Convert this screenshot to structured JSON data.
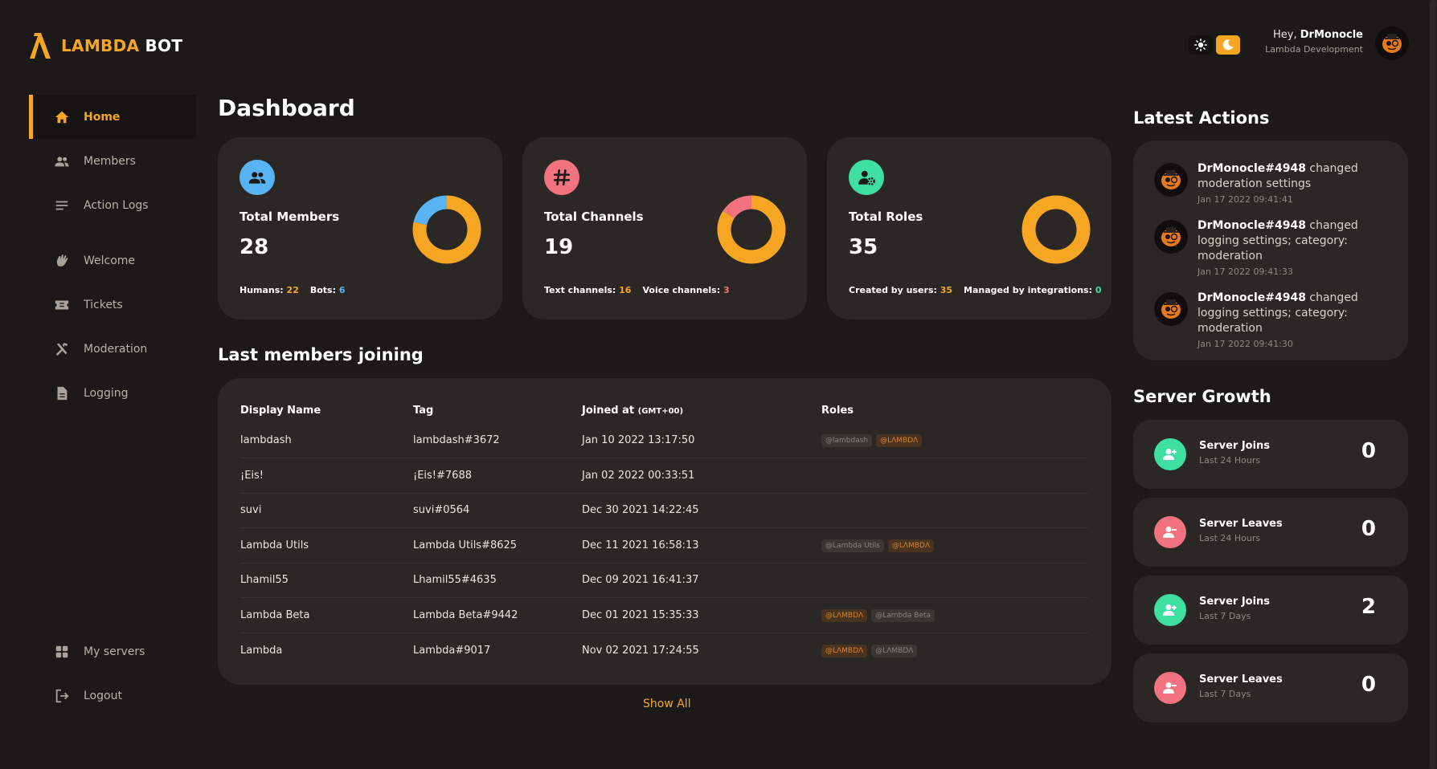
{
  "brand": {
    "name_accent": "LAMBDA",
    "name_rest": " BOT",
    "accent_color": "#f6a623"
  },
  "sidebar": {
    "items": [
      {
        "label": "Home",
        "icon": "home-icon",
        "active": true
      },
      {
        "label": "Members",
        "icon": "members-icon"
      },
      {
        "label": "Action Logs",
        "icon": "list-icon"
      },
      {
        "label": "Welcome",
        "icon": "wave-hand-icon"
      },
      {
        "label": "Tickets",
        "icon": "ticket-icon"
      },
      {
        "label": "Moderation",
        "icon": "tools-icon"
      },
      {
        "label": "Logging",
        "icon": "document-icon"
      }
    ],
    "bottom": [
      {
        "label": "My servers",
        "icon": "grid-icon"
      },
      {
        "label": "Logout",
        "icon": "logout-icon"
      }
    ]
  },
  "header": {
    "greeting": "Hey, ",
    "username": "DrMonocle",
    "organization": "Lambda Development",
    "theme": {
      "light_icon": "sun-icon",
      "dark_icon": "moon-icon",
      "selected": "dark"
    }
  },
  "main": {
    "title": "Dashboard",
    "stats": [
      {
        "label": "Total Members",
        "value": "28",
        "icon": "members-icon",
        "icon_color": "#58b4f5",
        "sub": [
          {
            "label": "Humans:",
            "value": "22",
            "color": "#f6a623"
          },
          {
            "label": "Bots:",
            "value": "6",
            "color": "#58b4f5"
          }
        ],
        "donut": {
          "values": [
            22,
            6
          ],
          "colors": [
            "#f6a623",
            "#58b4f5"
          ]
        }
      },
      {
        "label": "Total Channels",
        "value": "19",
        "icon": "hash-icon",
        "icon_color": "#f2727f",
        "sub": [
          {
            "label": "Text channels:",
            "value": "16",
            "color": "#f6a623"
          },
          {
            "label": "Voice channels:",
            "value": "3",
            "color": "#f2727f"
          }
        ],
        "donut": {
          "values": [
            16,
            3
          ],
          "colors": [
            "#f6a623",
            "#f2727f"
          ]
        }
      },
      {
        "label": "Total Roles",
        "value": "35",
        "icon": "role-settings-icon",
        "icon_color": "#3ee0a1",
        "sub": [
          {
            "label": "Created by users:",
            "value": "35",
            "color": "#f6a623"
          },
          {
            "label": "Managed by integrations:",
            "value": "0",
            "color": "#3ee0a1"
          }
        ],
        "donut": {
          "values": [
            35,
            0
          ],
          "colors": [
            "#f6a623",
            "#3ee0a1"
          ]
        }
      }
    ],
    "members_title": "Last members joining",
    "table": {
      "headers": [
        "Display Name",
        "Tag",
        "Joined at",
        "Roles"
      ],
      "timezone": "(GMT+00)",
      "rows": [
        {
          "name": "lambdash",
          "tag": "lambdash#3672",
          "joined": "Jan 10 2022 13:17:50",
          "roles": [
            {
              "text": "@lambdash",
              "style": "grey"
            },
            {
              "text": "@LΛMBDΛ",
              "style": "orange"
            }
          ]
        },
        {
          "name": "¡Eis!",
          "tag": "¡Eis!#7688",
          "joined": "Jan 02 2022 00:33:51",
          "roles": []
        },
        {
          "name": "suvi",
          "tag": "suvi#0564",
          "joined": "Dec 30 2021 14:22:45",
          "roles": []
        },
        {
          "name": "Lambda Utils",
          "tag": "Lambda Utils#8625",
          "joined": "Dec 11 2021 16:58:13",
          "roles": [
            {
              "text": "@Lambda Utils",
              "style": "grey"
            },
            {
              "text": "@LΛMBDΛ",
              "style": "orange"
            }
          ]
        },
        {
          "name": "Lhamil55",
          "tag": "Lhamil55#4635",
          "joined": "Dec 09 2021 16:41:37",
          "roles": []
        },
        {
          "name": "Lambda Beta",
          "tag": "Lambda Beta#9442",
          "joined": "Dec 01 2021 15:35:33",
          "roles": [
            {
              "text": "@LΛMBDΛ",
              "style": "orange"
            },
            {
              "text": "@Lambda Beta",
              "style": "grey"
            }
          ]
        },
        {
          "name": "Lambda",
          "tag": "Lambda#9017",
          "joined": "Nov 02 2021 17:24:55",
          "roles": [
            {
              "text": "@LΛMBDΛ",
              "style": "orange"
            },
            {
              "text": "@LΛMBDΛ",
              "style": "grey"
            }
          ]
        }
      ]
    },
    "show_all": "Show All"
  },
  "right": {
    "actions_title": "Latest Actions",
    "actions": [
      {
        "user": "DrMonocle#4948",
        "text": " changed moderation settings",
        "time": "Jan 17 2022 09:41:41"
      },
      {
        "user": "DrMonocle#4948",
        "text": " changed logging settings; category: moderation",
        "time": "Jan 17 2022 09:41:33"
      },
      {
        "user": "DrMonocle#4948",
        "text": " changed logging settings; category: moderation",
        "time": "Jan 17 2022 09:41:30"
      }
    ],
    "growth_title": "Server Growth",
    "growth": [
      {
        "label": "Server Joins",
        "sub": "Last 24 Hours",
        "value": "0",
        "type": "join",
        "color": "#3ee0a1"
      },
      {
        "label": "Server Leaves",
        "sub": "Last 24 Hours",
        "value": "0",
        "type": "leave",
        "color": "#f2727f"
      },
      {
        "label": "Server Joins",
        "sub": "Last 7 Days",
        "value": "2",
        "type": "join",
        "color": "#3ee0a1"
      },
      {
        "label": "Server Leaves",
        "sub": "Last 7 Days",
        "value": "0",
        "type": "leave",
        "color": "#f2727f"
      }
    ]
  }
}
